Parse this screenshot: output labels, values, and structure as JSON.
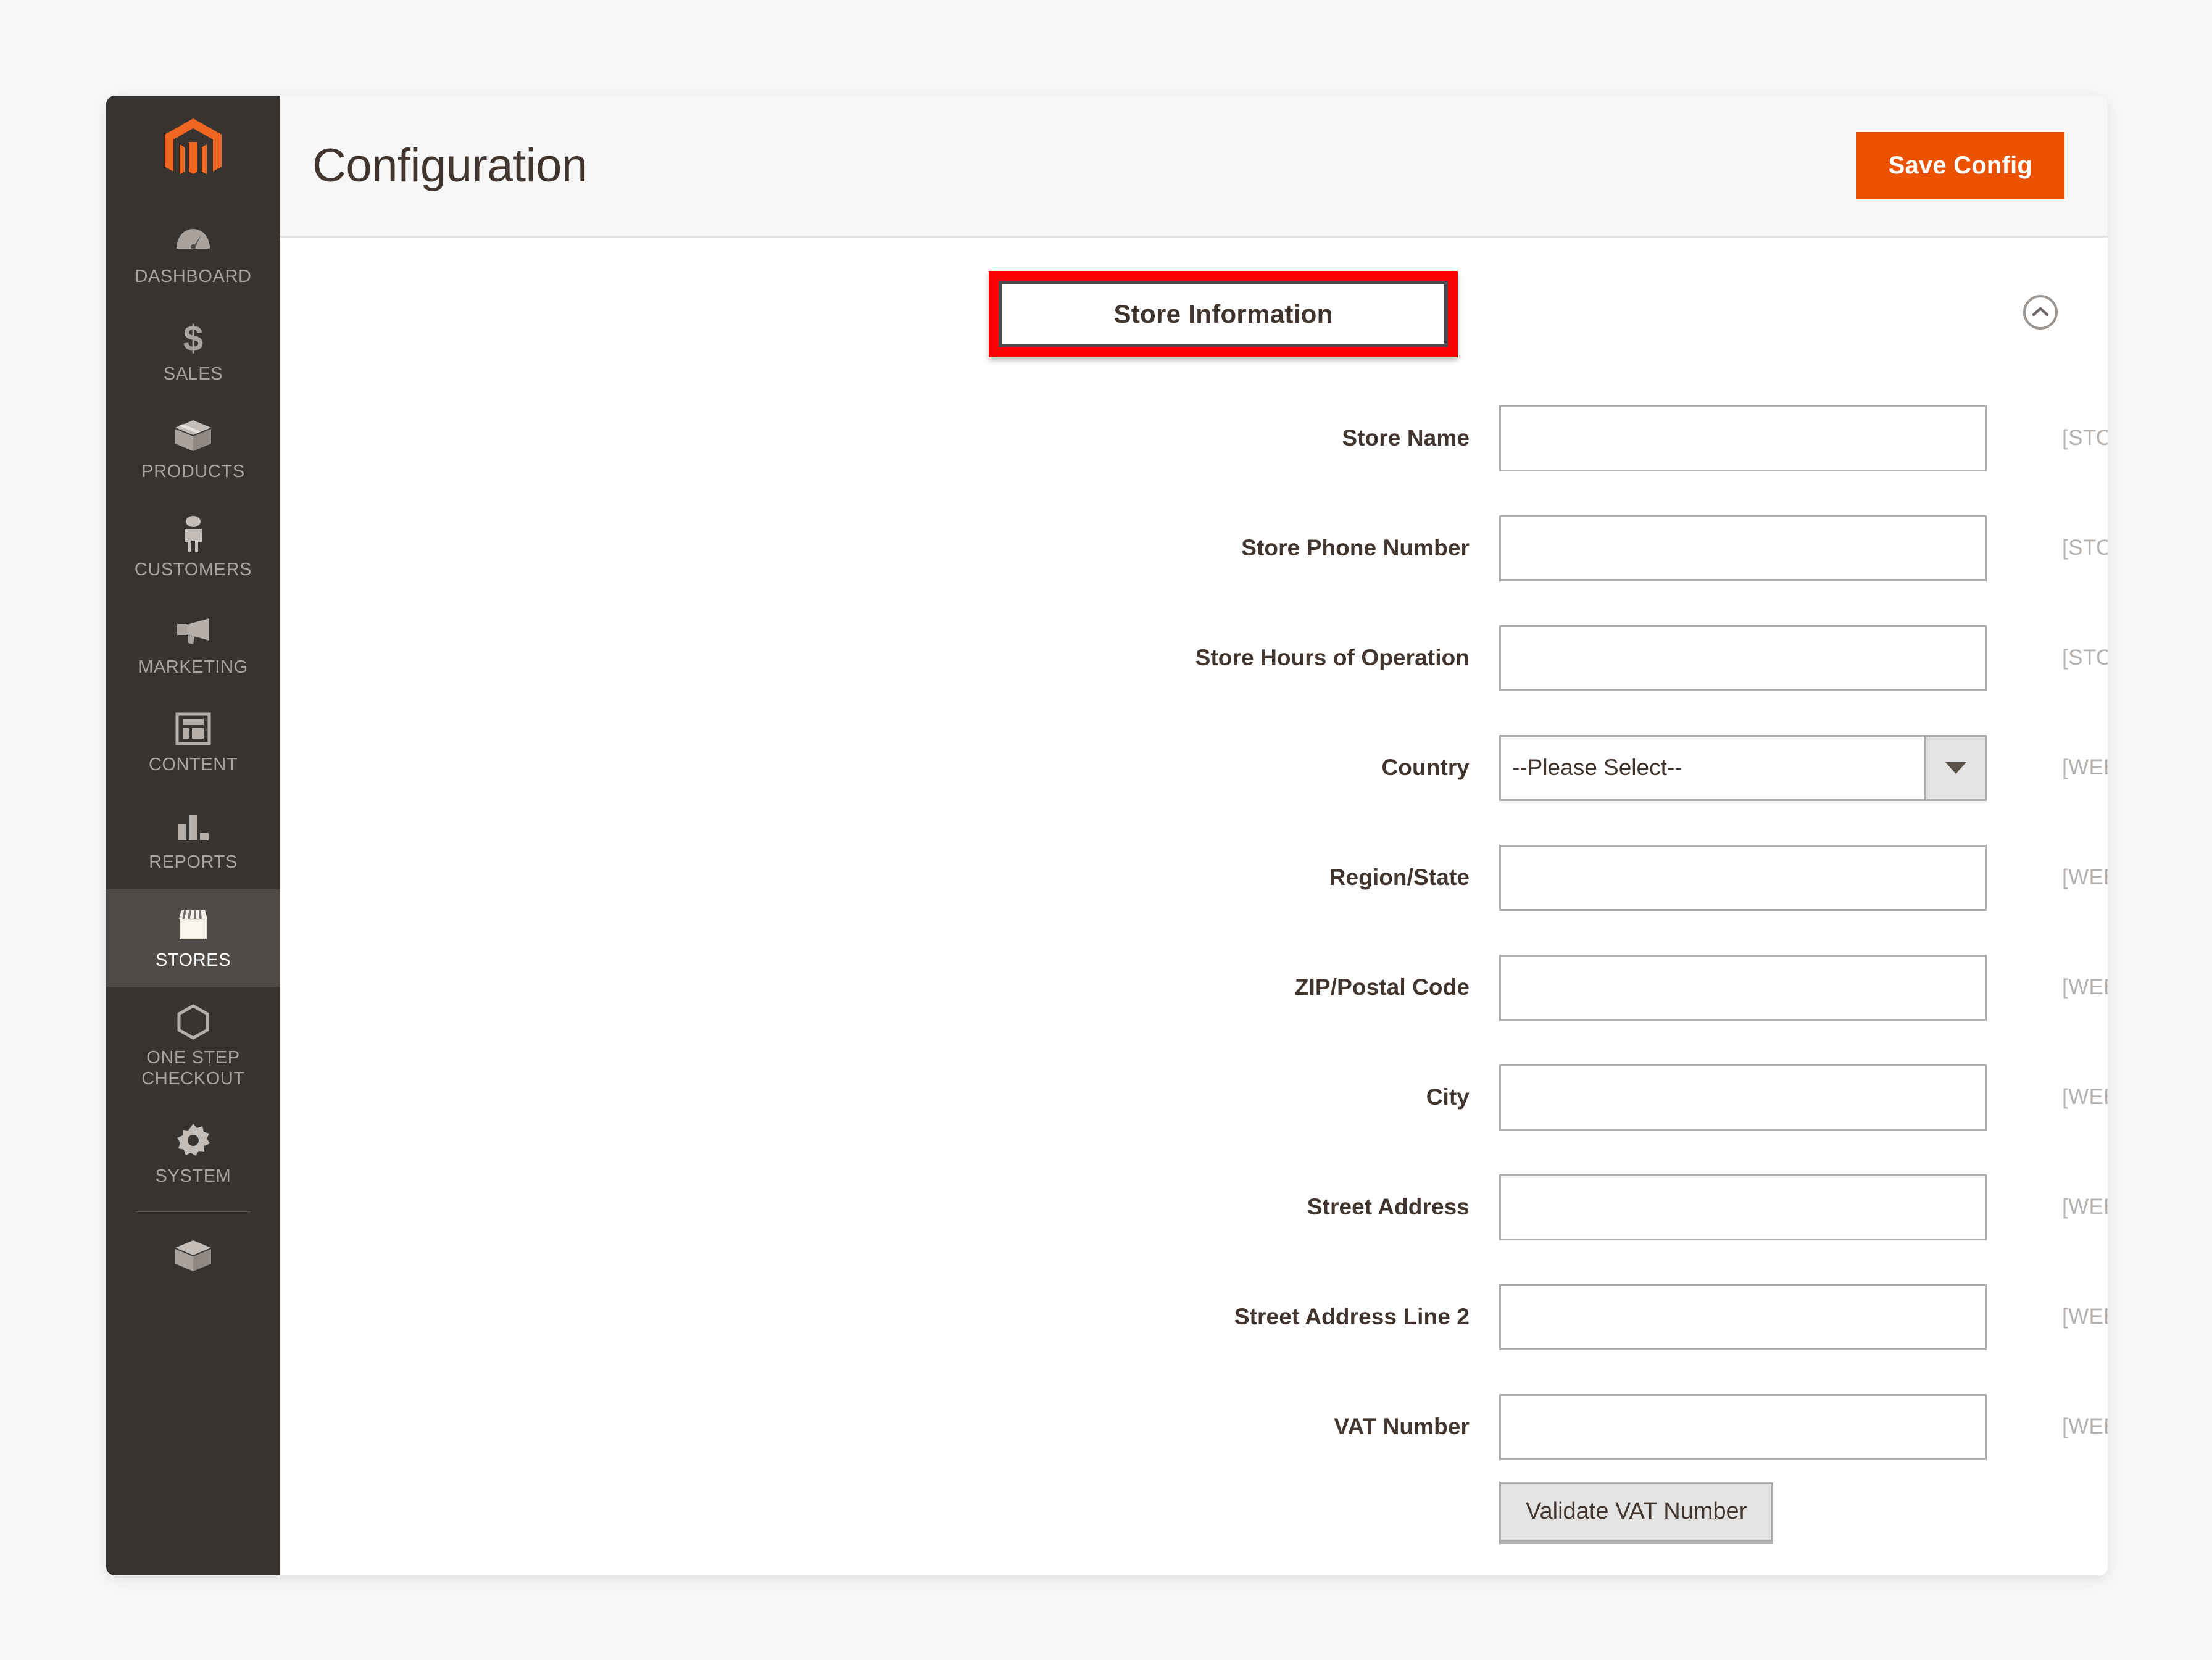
{
  "sidebar": {
    "logo_name": "magento-logo",
    "items": [
      {
        "label": "DASHBOARD",
        "icon": "dashboard-gauge-icon",
        "active": false
      },
      {
        "label": "SALES",
        "icon": "dollar-sign-icon",
        "active": false
      },
      {
        "label": "PRODUCTS",
        "icon": "box-icon",
        "active": false
      },
      {
        "label": "CUSTOMERS",
        "icon": "person-icon",
        "active": false
      },
      {
        "label": "MARKETING",
        "icon": "megaphone-icon",
        "active": false
      },
      {
        "label": "CONTENT",
        "icon": "layout-page-icon",
        "active": false
      },
      {
        "label": "REPORTS",
        "icon": "bar-chart-icon",
        "active": false
      },
      {
        "label": "STORES",
        "icon": "storefront-icon",
        "active": true
      },
      {
        "label": "ONE STEP CHECKOUT",
        "icon": "hexagon-outline-icon",
        "active": false
      },
      {
        "label": "SYSTEM",
        "icon": "gear-icon",
        "active": false
      },
      {
        "label": "",
        "icon": "extension-box-icon",
        "active": false
      }
    ]
  },
  "header": {
    "title": "Configuration",
    "save_label": "Save Config",
    "save_color": "#eb5202"
  },
  "section": {
    "title": "Store Information",
    "highlight_color": "#fe0000",
    "collapse_icon": "chevron-up-circle-icon"
  },
  "form": {
    "fields": [
      {
        "label": "Store Name",
        "type": "text",
        "value": "",
        "scope": "[STORE VIEW]",
        "name": "store-name"
      },
      {
        "label": "Store Phone Number",
        "type": "text",
        "value": "",
        "scope": "[STORE VIEW]",
        "name": "store-phone-number"
      },
      {
        "label": "Store Hours of Operation",
        "type": "text",
        "value": "",
        "scope": "[STORE VIEW]",
        "name": "store-hours-of-operation"
      },
      {
        "label": "Country",
        "type": "select",
        "value": "--Please Select--",
        "scope": "[WEBSITE]",
        "name": "country"
      },
      {
        "label": "Region/State",
        "type": "text",
        "value": "",
        "scope": "[WEBSITE]",
        "name": "region-state"
      },
      {
        "label": "ZIP/Postal Code",
        "type": "text",
        "value": "",
        "scope": "[WEBSITE]",
        "name": "zip-postal-code"
      },
      {
        "label": "City",
        "type": "text",
        "value": "",
        "scope": "[WEBSITE]",
        "name": "city"
      },
      {
        "label": "Street Address",
        "type": "text",
        "value": "",
        "scope": "[WEBSITE]",
        "name": "street-address"
      },
      {
        "label": "Street Address Line 2",
        "type": "text",
        "value": "",
        "scope": "[WEBSITE]",
        "name": "street-address-line-2"
      },
      {
        "label": "VAT Number",
        "type": "text",
        "value": "",
        "scope": "[WEBSITE]",
        "name": "vat-number"
      }
    ],
    "validate_vat_label": "Validate VAT Number"
  }
}
